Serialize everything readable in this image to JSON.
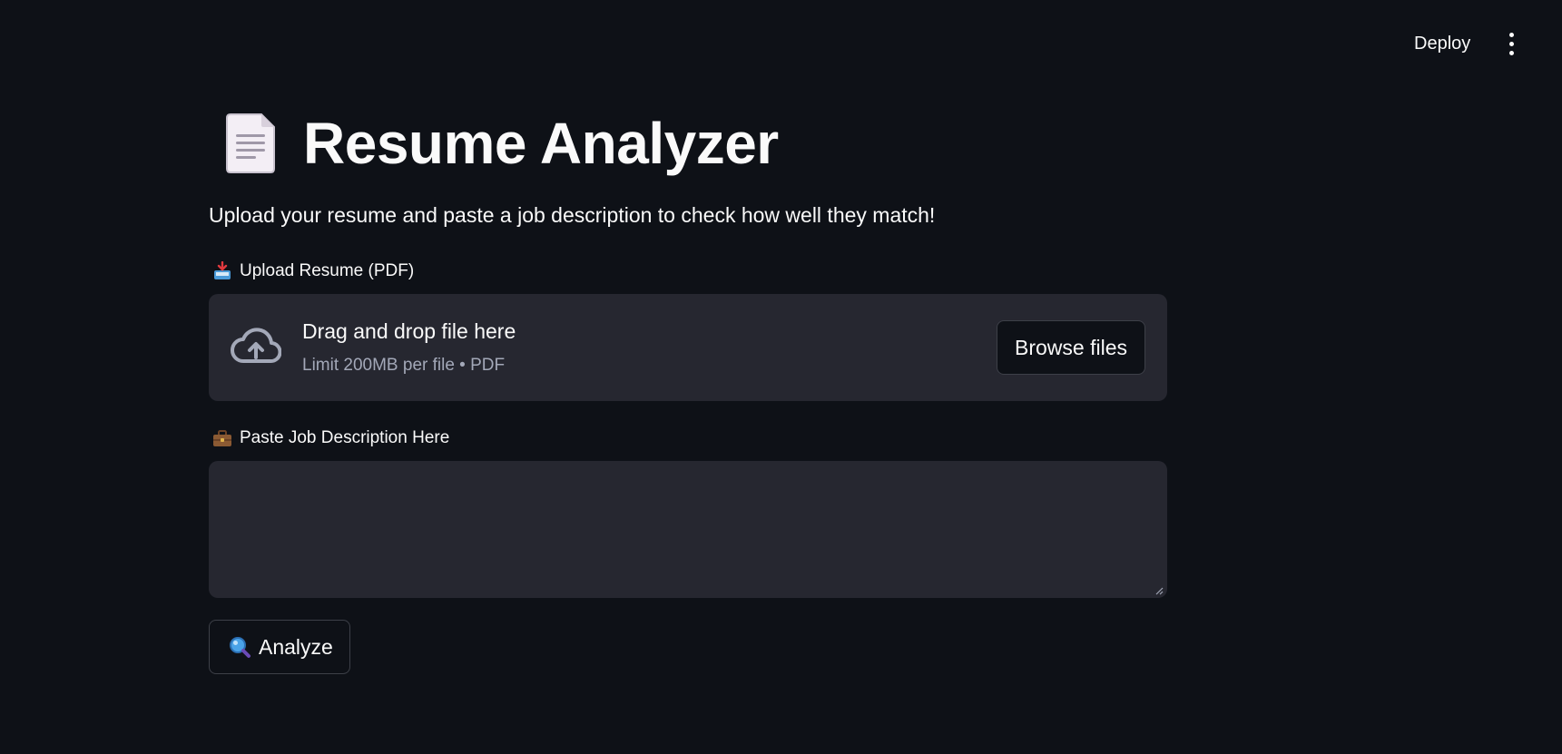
{
  "header": {
    "deploy_label": "Deploy",
    "menu_icon": "kebab-menu-icon"
  },
  "page": {
    "title_icon": "page-facing-up-emoji",
    "title": "Resume Analyzer",
    "subtitle": "Upload your resume and paste a job description to check how well they match!"
  },
  "upload": {
    "label_icon": "inbox-tray-emoji",
    "label": "Upload Resume (PDF)",
    "dropzone_icon": "cloud-upload-icon",
    "dropzone_title": "Drag and drop file here",
    "dropzone_limit": "Limit 200MB per file • PDF",
    "browse_label": "Browse files"
  },
  "job": {
    "label_icon": "briefcase-emoji",
    "label": "Paste Job Description Here",
    "value": "",
    "placeholder": ""
  },
  "analyze": {
    "icon": "magnifying-glass-emoji",
    "label": "Analyze"
  },
  "colors": {
    "background": "#0e1117",
    "surface": "#262730",
    "text": "#fafafa",
    "muted_text": "#a3a8b8",
    "border": "#3d4048"
  }
}
